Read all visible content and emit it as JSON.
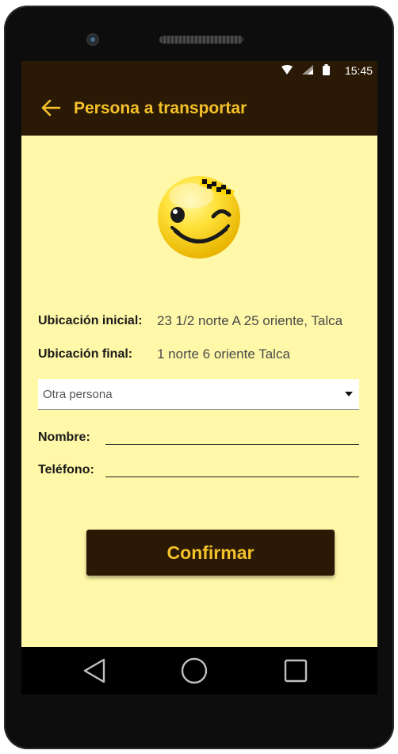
{
  "status_bar": {
    "time": "15:45",
    "icons": [
      "wifi-icon",
      "signal-icon",
      "battery-icon"
    ]
  },
  "app_bar": {
    "title": "Persona a transportar",
    "back_icon": "arrow-left-icon"
  },
  "colors": {
    "primary_dark": "#2a1a05",
    "accent": "#f5c12a",
    "background": "#fff8a8"
  },
  "trip": {
    "origin_label": "Ubicación inicial:",
    "origin_value": "23 1/2 norte A 25 oriente, Talca",
    "destination_label": "Ubicación final:",
    "destination_value": "1 norte 6 oriente Talca"
  },
  "passenger_select": {
    "selected": "Otra persona"
  },
  "form": {
    "name_label": "Nombre:",
    "phone_label": "Teléfono:",
    "name_value": "",
    "phone_value": ""
  },
  "confirm_label": "Confirmar",
  "nav": {
    "back": "triangle-back-icon",
    "home": "circle-home-icon",
    "recents": "square-recents-icon"
  }
}
